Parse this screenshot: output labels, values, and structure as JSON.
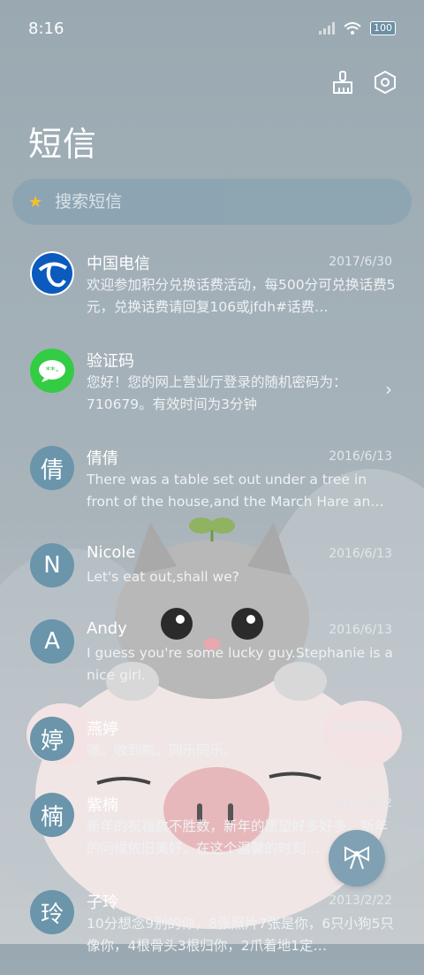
{
  "status_bar": {
    "time": "8:16",
    "battery": "100",
    "icons": [
      "signal-icon",
      "wifi-icon",
      "battery-icon"
    ]
  },
  "header": {
    "title": "短信",
    "icons": [
      "broom-icon",
      "settings-icon"
    ]
  },
  "search": {
    "placeholder": "搜索短信"
  },
  "messages": [
    {
      "name": "中国电信",
      "date": "2017/6/30",
      "avatar": "china-telecom-logo",
      "preview": "欢迎参加积分兑换话费活动，每500分可兑换话费5元，兑换话费请回复106或jfdh#话费…"
    },
    {
      "name": "验证码",
      "date": "",
      "avatar": "message-bubble-icon",
      "preview": "您好！您的网上营业厅登录的随机密码为：710679。有效时间为3分钟"
    },
    {
      "name": "倩倩",
      "date": "2016/6/13",
      "avatar": "倩",
      "preview": "There was a table set out under a tree in front of the house,and the March Hare an…"
    },
    {
      "name": "Nicole",
      "date": "2016/6/13",
      "avatar": "N",
      "preview": "Let's eat out,shall we?"
    },
    {
      "name": "Andy",
      "date": "2016/6/13",
      "avatar": "A",
      "preview": "I guess you're some lucky guy.Stephanie is a nice girl."
    },
    {
      "name": "燕婷",
      "date": "2013/2/22",
      "avatar": "婷",
      "preview": "嗯。收到啦。同乐同乐。"
    },
    {
      "name": "紫楠",
      "date": "2013/2/22",
      "avatar": "楠",
      "preview": "新年的祝福数不胜数，新年的愿望好多好多，新年的问候依旧美好，在这个温馨的时刻…"
    },
    {
      "name": "子玲",
      "date": "2013/2/22",
      "avatar": "玲",
      "preview": "10分想念9别的你，8张照片7张是你，6只小狗5只像你，4根骨头3根归你，2爪着地1定…"
    }
  ],
  "fab": {
    "icon": "bow-icon"
  },
  "colors": {
    "accent": "#7fa1b3",
    "avatar": "#6a95aa",
    "star": "#f7c02a",
    "green": "#33cc44",
    "telecom_blue": "#0a5bbd"
  }
}
